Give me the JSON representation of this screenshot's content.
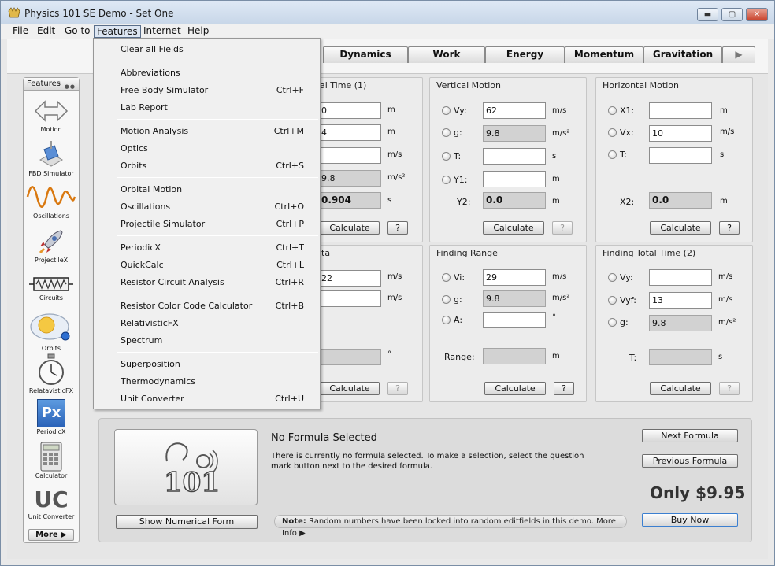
{
  "window": {
    "title": "Physics 101 SE Demo - Set One",
    "minimize_glyph": "▬",
    "maximize_glyph": "▢",
    "close_glyph": "✕"
  },
  "menubar": [
    "File",
    "Edit",
    "Go to",
    "Features",
    "Internet",
    "Help"
  ],
  "tabs": [
    "Dynamics",
    "Work",
    "Energy",
    "Momentum",
    "Gravitation"
  ],
  "tab_arrow": "▶",
  "sidebar": {
    "title": "Features",
    "dots": "●●",
    "items": [
      "Motion",
      "FBD Simulator",
      "Oscillations",
      "ProjectileX",
      "Circuits",
      "Orbits",
      "RelatavisticFX",
      "PeriodicX",
      "Calculator",
      "Unit Converter"
    ],
    "periodic_icon_text": "Px",
    "uc_icon_text": "UC",
    "more_label": "More ▶"
  },
  "panels": {
    "total_time_1": {
      "title": "al Time (1)",
      "fields": [
        {
          "value": "0",
          "unit": "m"
        },
        {
          "value": "4",
          "unit": "m"
        },
        {
          "value": "",
          "unit": "m/s"
        },
        {
          "value": "9.8",
          "unit": "m/s²"
        }
      ],
      "result": {
        "value": "0.904",
        "unit": "s"
      },
      "calc_label": "Calculate",
      "help_label": "?"
    },
    "vertical_motion": {
      "title": "Vertical Motion",
      "fields": [
        {
          "label": "Vy:",
          "value": "62",
          "unit": "m/s"
        },
        {
          "label": "g:",
          "value": "9.8",
          "unit": "m/s²"
        },
        {
          "label": "T:",
          "value": "",
          "unit": "s"
        },
        {
          "label": "Y1:",
          "value": "",
          "unit": "m"
        }
      ],
      "result": {
        "label": "Y2:",
        "value": "0.0",
        "unit": "m"
      },
      "calc_label": "Calculate",
      "help_label": "?"
    },
    "horizontal_motion": {
      "title": "Horizontal Motion",
      "fields": [
        {
          "label": "X1:",
          "value": "",
          "unit": "m"
        },
        {
          "label": "Vx:",
          "value": "10",
          "unit": "m/s"
        },
        {
          "label": "T:",
          "value": "",
          "unit": "s"
        }
      ],
      "result": {
        "label": "X2:",
        "value": "0.0",
        "unit": "m"
      },
      "calc_label": "Calculate",
      "help_label": "?"
    },
    "theta": {
      "title": "ta",
      "fields": [
        {
          "value": "22",
          "unit": "m/s"
        },
        {
          "value": "",
          "unit": "m/s"
        }
      ],
      "result": {
        "value": "",
        "unit": "°"
      },
      "calc_label": "Calculate",
      "help_label": "?"
    },
    "finding_range": {
      "title": "Finding Range",
      "fields": [
        {
          "label": "Vi:",
          "value": "29",
          "unit": "m/s"
        },
        {
          "label": "g:",
          "value": "9.8",
          "unit": "m/s²"
        },
        {
          "label": "A:",
          "value": "",
          "unit": "°"
        }
      ],
      "result": {
        "label": "Range:",
        "value": "",
        "unit": "m"
      },
      "calc_label": "Calculate",
      "help_label": "?"
    },
    "total_time_2": {
      "title": "Finding Total Time (2)",
      "fields": [
        {
          "label": "Vy:",
          "value": "",
          "unit": "m/s"
        },
        {
          "label": "Vyf:",
          "value": "13",
          "unit": "m/s"
        },
        {
          "label": "g:",
          "value": "9.8",
          "unit": "m/s²"
        }
      ],
      "result": {
        "label": "T:",
        "value": "",
        "unit": "s"
      },
      "calc_label": "Calculate",
      "help_label": "?"
    }
  },
  "bottom": {
    "logo_text": "101",
    "show_numerical_label": "Show Numerical Form",
    "formula_title": "No Formula Selected",
    "formula_desc": "There is currently no formula selected. To make a selection, select the question mark button next to the desired formula.",
    "note_prefix": "Note:",
    "note_text": "Random numbers have been locked into random editfields in this demo. More Info ▶",
    "next_label": "Next Formula",
    "prev_label": "Previous Formula",
    "price": "Only $9.95",
    "buy_label": "Buy Now"
  },
  "features_menu": {
    "groups": [
      [
        {
          "label": "Clear all Fields",
          "shortcut": ""
        }
      ],
      [
        {
          "label": "Abbreviations",
          "shortcut": ""
        },
        {
          "label": "Free Body Simulator",
          "shortcut": "Ctrl+F"
        },
        {
          "label": "Lab Report",
          "shortcut": ""
        }
      ],
      [
        {
          "label": "Motion Analysis",
          "shortcut": "Ctrl+M"
        },
        {
          "label": "Optics",
          "shortcut": ""
        },
        {
          "label": "Orbits",
          "shortcut": "Ctrl+S"
        }
      ],
      [
        {
          "label": "Orbital Motion",
          "shortcut": ""
        },
        {
          "label": "Oscillations",
          "shortcut": "Ctrl+O"
        },
        {
          "label": "Projectile Simulator",
          "shortcut": "Ctrl+P"
        }
      ],
      [
        {
          "label": "PeriodicX",
          "shortcut": "Ctrl+T"
        },
        {
          "label": "QuickCalc",
          "shortcut": "Ctrl+L"
        },
        {
          "label": "Resistor Circuit Analysis",
          "shortcut": "Ctrl+R"
        }
      ],
      [
        {
          "label": "Resistor Color Code Calculator",
          "shortcut": "Ctrl+B"
        },
        {
          "label": "RelativisticFX",
          "shortcut": ""
        },
        {
          "label": "Spectrum",
          "shortcut": ""
        }
      ],
      [
        {
          "label": "Superposition",
          "shortcut": ""
        },
        {
          "label": "Thermodynamics",
          "shortcut": ""
        },
        {
          "label": "Unit Converter",
          "shortcut": "Ctrl+U"
        }
      ]
    ]
  },
  "colors": {
    "titlebar": "#c7d6e8",
    "window_bg": "#e9e9e9",
    "readonly_field": "#d2d2d2",
    "close_button": "#c8412a",
    "buy_button_border": "#3b7fd0"
  }
}
